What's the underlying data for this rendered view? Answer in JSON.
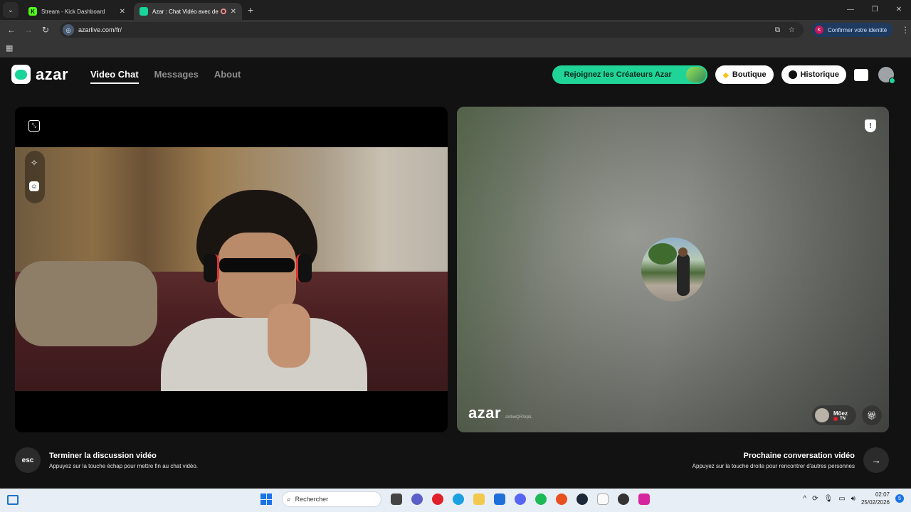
{
  "browser": {
    "tabs": [
      {
        "title": "Stream - Kick Dashboard",
        "favicon_letter": "K",
        "favicon_color": "#53fc18",
        "active": false
      },
      {
        "title": "Azar : Chat Vidéo avec de n",
        "favicon_letter": "",
        "favicon_color": "#19d49b",
        "active": true
      }
    ],
    "new_tab": "+",
    "url": "azarlive.com/fr/",
    "identity_label": "Confirmer votre identité",
    "identity_letter": "K"
  },
  "site": {
    "logo": "azar",
    "nav": [
      {
        "label": "Video Chat",
        "active": true
      },
      {
        "label": "Messages",
        "active": false
      },
      {
        "label": "About",
        "active": false
      }
    ],
    "creators_button": "Rejoignez les Créateurs Azar",
    "shop_button": "Boutique",
    "history_button": "Historique",
    "accent_color": "#20d497"
  },
  "remote": {
    "watermark_brand": "azar",
    "watermark_code": "aVbwQRXqkL",
    "user_name": "Möez",
    "user_country": "TN"
  },
  "controls": {
    "esc_key": "esc",
    "end_title": "Terminer la discussion vidéo",
    "end_subtitle": "Appuyez sur la touche échap pour mettre fin au chat vidéo.",
    "next_title": "Prochaine conversation vidéo",
    "next_subtitle": "Appuyez sur la touche droite pour rencontrer d'autres personnes"
  },
  "taskbar": {
    "search_placeholder": "Rechercher",
    "time": "02:07",
    "date": "25/02/2026",
    "notification_count": "5"
  }
}
